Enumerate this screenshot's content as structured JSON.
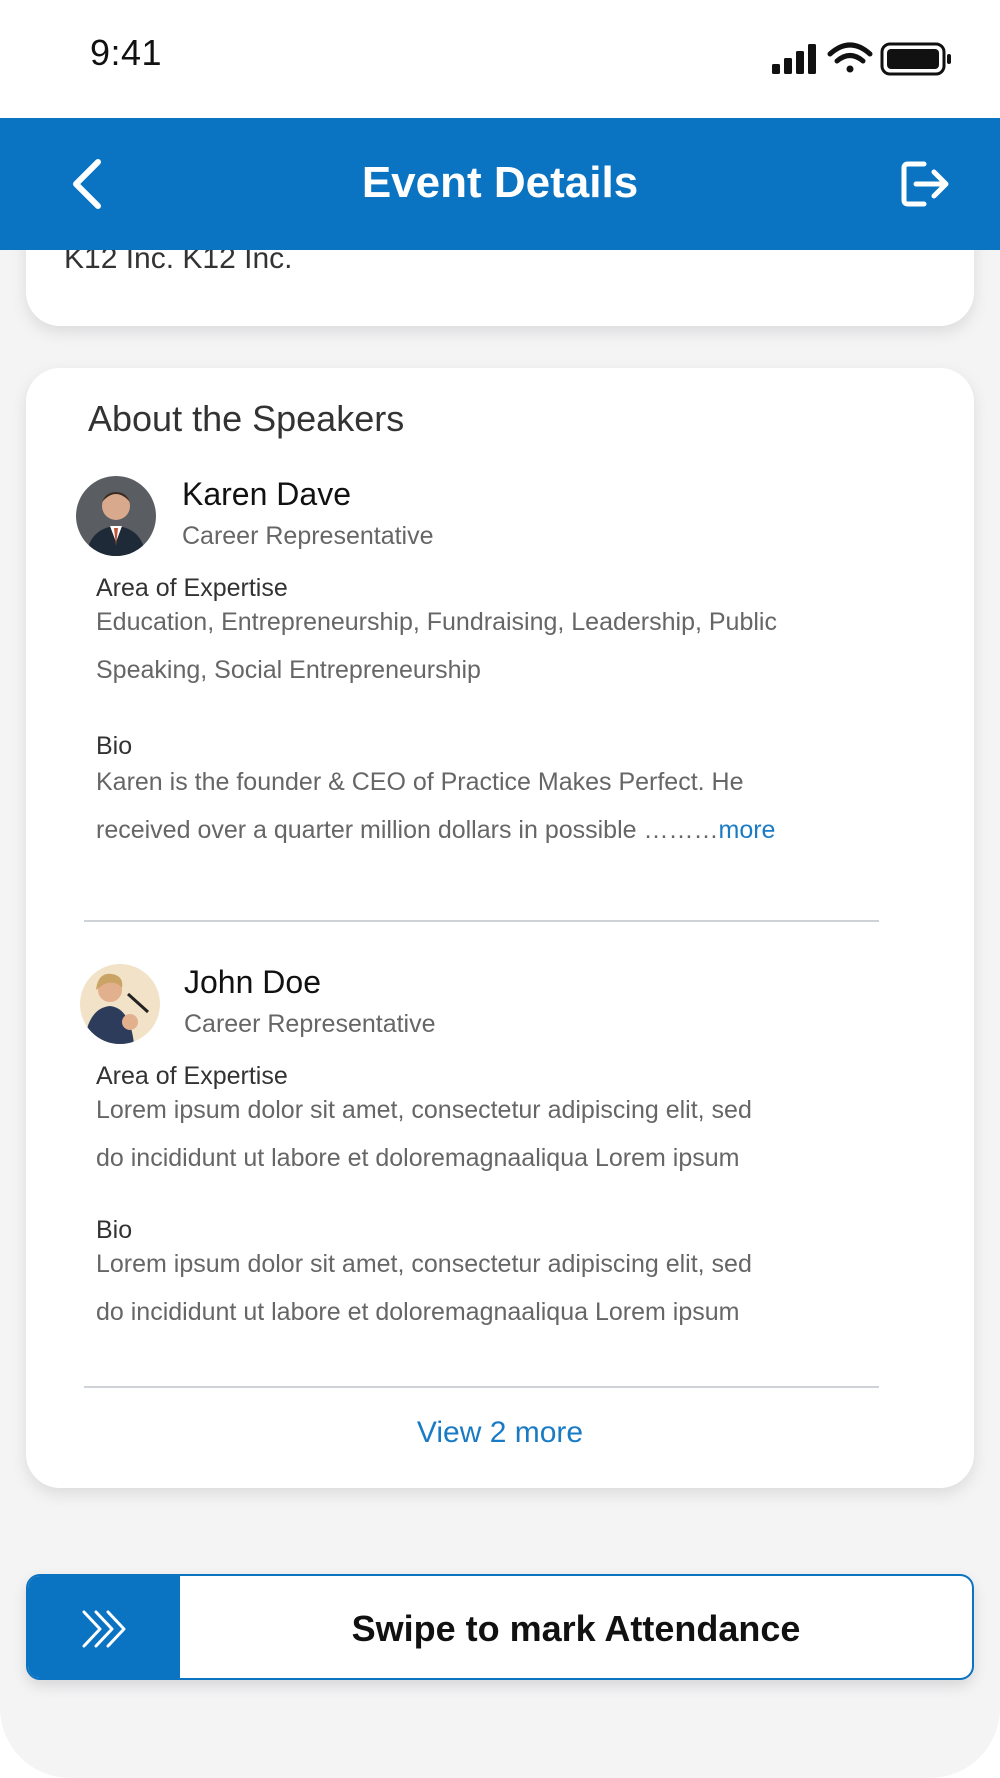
{
  "status_bar": {
    "time": "9:41"
  },
  "app_bar": {
    "title": "Event Details"
  },
  "top_card": {
    "org_text": "K12 Inc. K12 Inc."
  },
  "speakers_section": {
    "title": "About the Speakers",
    "speakers": [
      {
        "name": "Karen Dave",
        "role": "Career Representative",
        "expertise_label": "Area of Expertise",
        "expertise_line1": "Education, Entrepreneurship, Fundraising, Leadership,  Public",
        "expertise_line2": "Speaking, Social Entrepreneurship",
        "bio_label": "Bio",
        "bio_line1": "Karen is the founder & CEO of Practice Makes Perfect. He",
        "bio_line2": "received over a quarter million dollars in possible ………",
        "more_link": "more"
      },
      {
        "name": "John Doe",
        "role": "Career Representative",
        "expertise_label": "Area of Expertise",
        "expertise_line1": "Lorem ipsum dolor sit amet, consectetur adipiscing elit, sed",
        "expertise_line2": "do  incididunt ut labore et doloremagnaaliqua Lorem ipsum",
        "bio_label": "Bio",
        "bio_line1": "Lorem ipsum dolor sit amet, consectetur adipiscing elit, sed",
        "bio_line2": "do  incididunt ut labore et doloremagnaaliqua Lorem ipsum"
      }
    ],
    "view_more": "View 2 more"
  },
  "swipe": {
    "label": "Swipe to mark Attendance"
  },
  "colors": {
    "primary": "#0a73c2",
    "link": "#1a7bc4",
    "background": "#f4f4f5"
  }
}
